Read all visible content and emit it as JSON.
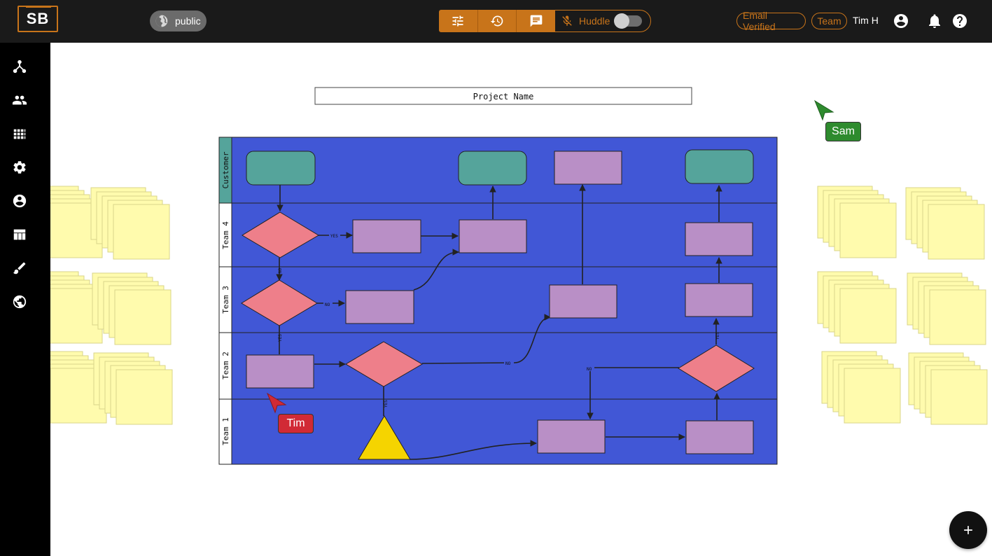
{
  "header": {
    "logo_text": "SB",
    "visibility_label": "public",
    "huddle_label": "Huddle",
    "email_badge": "Email Verified",
    "team_badge": "Team",
    "user_name": "Tim H"
  },
  "board": {
    "project_name": "Project Name",
    "lanes": [
      "Customer",
      "Team 4",
      "Team 3",
      "Team 2",
      "Team 1"
    ],
    "edge_labels": {
      "yes": "YES",
      "no": "NO"
    }
  },
  "cursors": [
    {
      "name": "Sam",
      "color": "#2e8b2e"
    },
    {
      "name": "Tim",
      "color": "#d12a35"
    }
  ],
  "colors": {
    "accent": "#c8741a",
    "lane_bg": "#4157d6",
    "lane_header": "#55a49b",
    "terminal": "#55a49b",
    "process": "#b98fc6",
    "decision": "#ee7f8a",
    "triangle": "#f5d400",
    "sticky": "#fffbad"
  },
  "icons": {
    "sidebar": [
      "hierarchy-icon",
      "people-icon",
      "apps-grid-icon",
      "gear-icon",
      "account-circle-icon",
      "table-layout-icon",
      "brush-icon",
      "globe-icon"
    ]
  }
}
